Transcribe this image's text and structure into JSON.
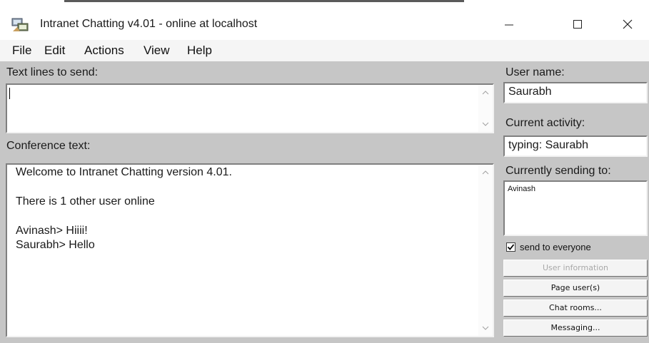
{
  "window": {
    "title": "Intranet Chatting v4.01 - online at localhost",
    "icon": "chat-app-icon",
    "controls": [
      "minimize-icon",
      "maximize-icon",
      "close-icon"
    ]
  },
  "menu": {
    "file": "File",
    "edit": "Edit",
    "actions": "Actions",
    "view": "View",
    "help": "Help"
  },
  "send_panel": {
    "label": "Text lines to send:",
    "value": ""
  },
  "conference": {
    "label": "Conference text:",
    "lines": [
      "Welcome to Intranet Chatting version 4.01.",
      "There is 1 other user online",
      "Avinash> Hiiii!",
      "Saurabh> Hello"
    ]
  },
  "sidebar": {
    "user_name_label": "User name:",
    "user_name": "Saurabh",
    "activity_label": "Current activity:",
    "activity": "typing: Saurabh",
    "sending_to_label": "Currently sending to:",
    "recipients": [
      "Avinash"
    ],
    "send_to_everyone_label": "send to everyone",
    "send_to_everyone_checked": true,
    "buttons": {
      "user_information": "User information",
      "page_users": "Page user(s)",
      "chat_rooms": "Chat rooms...",
      "messaging": "Messaging..."
    }
  },
  "colors": {
    "panel_background": "#c6c6c6",
    "text_area": "#ffffff",
    "disabled_text": "#a8a8a8"
  }
}
